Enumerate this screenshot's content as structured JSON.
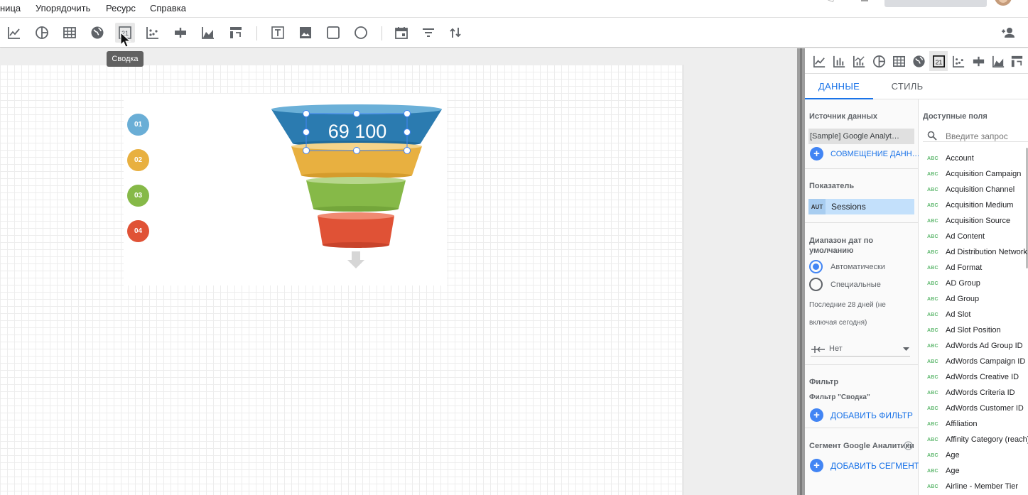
{
  "menu": [
    "ница",
    "Упорядочить",
    "Ресурс",
    "Справка"
  ],
  "tooltip": "Сводка",
  "canvas": {
    "steps": [
      "01",
      "02",
      "03",
      "04"
    ],
    "step_colors": [
      "#6aaed6",
      "#e8b040",
      "#86b948",
      "#e05236"
    ],
    "metric_value": "69 100"
  },
  "panel": {
    "tabs": [
      "ДАННЫЕ",
      "СТИЛЬ"
    ],
    "data_source_title": "Источник данных",
    "data_source_value": "[Sample] Google Analyt…",
    "blend_label": "СОВМЕЩЕНИЕ ДАНН…",
    "metric_title": "Показатель",
    "metric_type": "AUT",
    "metric_name": "Sessions",
    "date_range_title": "Диапазон дат по умолчанию",
    "radio_auto": "Автоматически",
    "radio_custom": "Специальные",
    "date_hint_1": "Последние 28 дней (не",
    "date_hint_2": "включая сегодня)",
    "compare_value": "Нет",
    "filter_title": "Фильтр",
    "filter_sub": "Фильтр \"Сводка\"",
    "add_filter": "ДОБАВИТЬ ФИЛЬТР",
    "segment_title": "Сегмент Google Аналитики",
    "add_segment": "ДОБАВИТЬ СЕГМЕНТ",
    "fields_title": "Доступные поля",
    "search_placeholder": "Введите запрос",
    "field_type": "ABC",
    "fields": [
      "Account",
      "Acquisition Campaign",
      "Acquisition Channel",
      "Acquisition Medium",
      "Acquisition Source",
      "Ad Content",
      "Ad Distribution Network",
      "Ad Format",
      "AD Group",
      "Ad Group",
      "Ad Slot",
      "Ad Slot Position",
      "AdWords Ad Group ID",
      "AdWords Campaign ID",
      "AdWords Creative ID",
      "AdWords Criteria ID",
      "AdWords Customer ID",
      "Affiliation",
      "Affinity Category (reach)",
      "Age",
      "Age",
      "Airline - Member Tier"
    ]
  },
  "colors": {
    "accent": "#1a73e8",
    "funnel_blue": "#2b7bb0",
    "funnel_yellow": "#e8b040",
    "funnel_green": "#86b948",
    "funnel_red": "#e05236"
  }
}
